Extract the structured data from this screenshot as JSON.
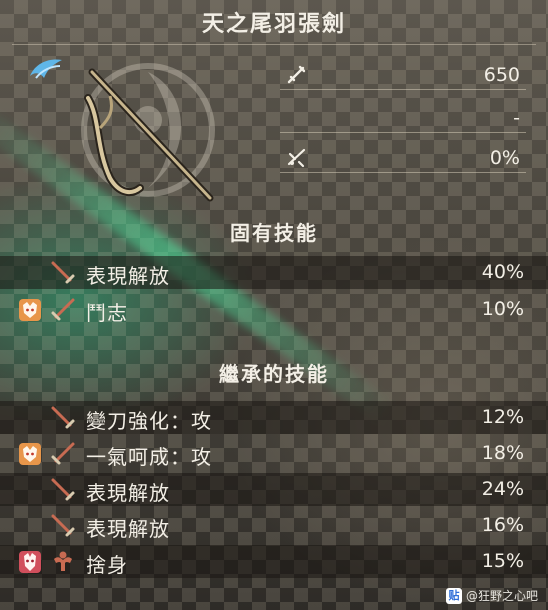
{
  "title": "天之尾羽張劍",
  "stats": [
    {
      "icon": "attack-icon",
      "value": "650"
    },
    {
      "icon": "",
      "value": "-"
    },
    {
      "icon": "affinity-icon",
      "value": "0%"
    }
  ],
  "sections": {
    "inherent": "固有技能",
    "inherited": "繼承的技能"
  },
  "inherent_skills": [
    {
      "badge": "",
      "icon": "sword-icon",
      "name": "表現解放",
      "percent": "40%"
    },
    {
      "badge": "fox-mask-badge-icon",
      "icon": "sword-icon",
      "name": "鬥志",
      "percent": "10%"
    }
  ],
  "inherited_skills": [
    {
      "badge": "",
      "icon": "sword-icon",
      "name": "變刀強化：攻",
      "percent": "12%"
    },
    {
      "badge": "fox-mask-badge-icon",
      "icon": "sword-icon",
      "name": "一氣呵成：攻",
      "percent": "18%"
    },
    {
      "badge": "",
      "icon": "sword-icon",
      "name": "表現解放",
      "percent": "24%"
    },
    {
      "badge": "",
      "icon": "sword-icon",
      "name": "表現解放",
      "percent": "16%"
    },
    {
      "badge": "kabuki-mask-badge-icon",
      "icon": "muscle-icon",
      "name": "捨身",
      "percent": "15%"
    }
  ],
  "watermark": "@狂野之心吧",
  "watermark_logo": "贴"
}
